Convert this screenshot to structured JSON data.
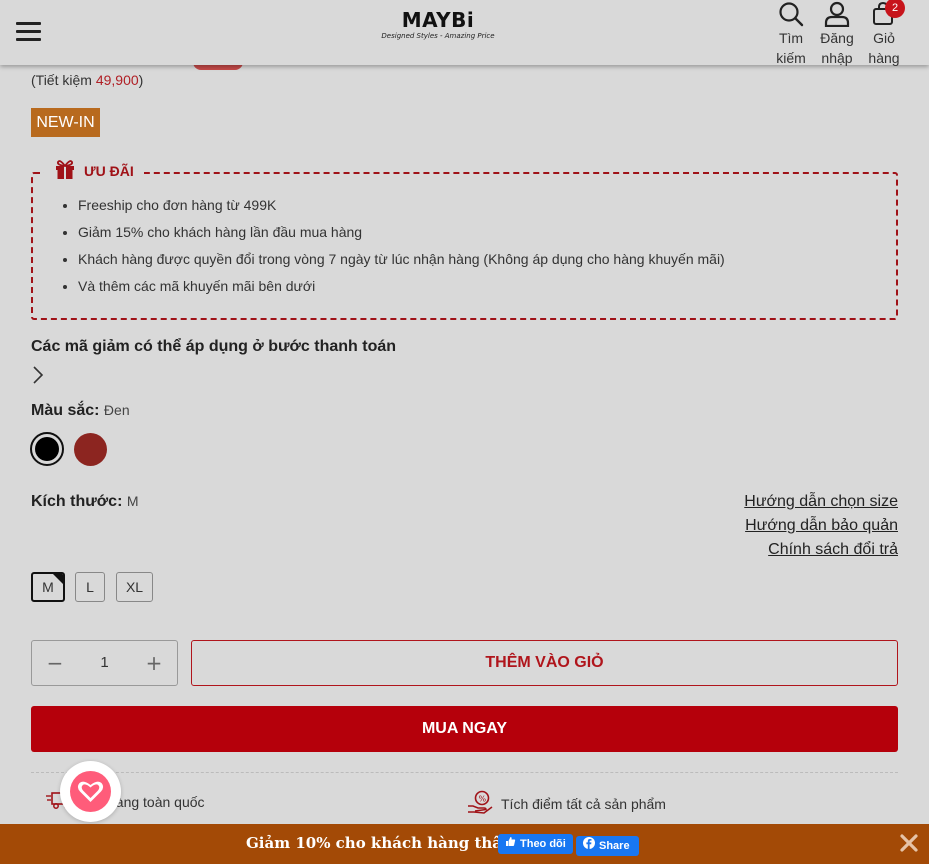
{
  "header": {
    "logo_text": "MAYBi",
    "logo_tagline": "Designed Styles - Amazing Price",
    "search_label": [
      "Tìm",
      "kiếm"
    ],
    "login_label": [
      "Đăng",
      "nhập"
    ],
    "cart_label": [
      "Giỏ",
      "hàng"
    ],
    "cart_count": "2"
  },
  "pricing": {
    "savings_prefix": "(Tiết kiệm ",
    "savings_amount": "49,900",
    "savings_suffix": ")",
    "tag": "NEW-IN"
  },
  "promo": {
    "title": "ƯU ĐÃI",
    "items": [
      "Freeship cho đơn hàng từ 499K",
      "Giảm 15% cho khách hàng lần đầu mua hàng",
      "Khách hàng được quyền đổi trong vòng 7 ngày từ lúc nhận hàng (Không áp dụng cho hàng khuyến mãi)",
      "Và thêm các mã khuyến mãi bên dưới"
    ]
  },
  "coupons": {
    "title": "Các mã giảm có thể áp dụng ở bước thanh toán"
  },
  "color": {
    "label": "Màu sắc:",
    "selected": "Đen",
    "swatches": [
      "#000000",
      "#8c2520"
    ]
  },
  "size": {
    "label": "Kích thước:",
    "selected": "M",
    "options": [
      "M",
      "L",
      "XL"
    ],
    "links": [
      "Hướng dẫn chọn size",
      "Hướng dẫn bảo quản",
      "Chính sách đổi trả"
    ]
  },
  "purchase": {
    "qty_minus": "−",
    "qty_value": "1",
    "qty_plus": "+",
    "add_to_cart": "THÊM VÀO GIỎ",
    "buy_now": "MUA NGAY"
  },
  "benefits": {
    "left": "hàng toàn quốc",
    "right": "Tích điểm tất cả sản phẩm"
  },
  "bottom_bar": {
    "text": "Giảm 10% cho khách hàng thân thiết",
    "follow": "Theo dõi",
    "share": "Share"
  },
  "colors": {
    "brand_red": "#b5000b",
    "accent_orange": "#a34a06",
    "facebook": "#1877f2"
  }
}
